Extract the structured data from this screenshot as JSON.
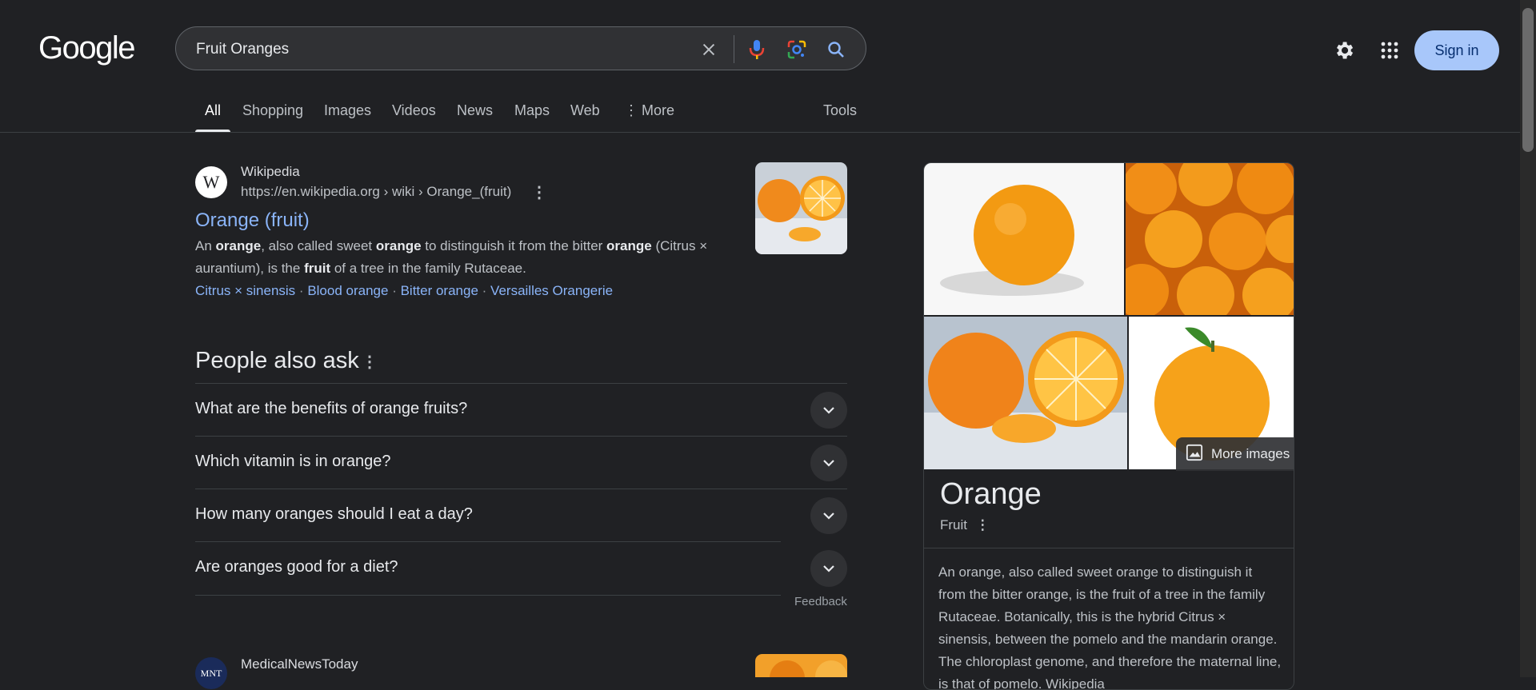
{
  "header": {
    "logo": "Google",
    "search_value": "Fruit Oranges",
    "signin_label": "Sign in"
  },
  "tabs": [
    {
      "label": "All",
      "active": true
    },
    {
      "label": "Shopping"
    },
    {
      "label": "Images"
    },
    {
      "label": "Videos"
    },
    {
      "label": "News"
    },
    {
      "label": "Maps"
    },
    {
      "label": "Web"
    },
    {
      "label": "More"
    }
  ],
  "tools_label": "Tools",
  "result": {
    "site_name": "Wikipedia",
    "url": "https://en.wikipedia.org › wiki › Orange_(fruit)",
    "favicon_letter": "W",
    "title": "Orange (fruit)",
    "snippet_parts": [
      "An ",
      "orange",
      ", also called sweet ",
      "orange",
      " to distinguish it from the bitter ",
      "orange",
      " (Citrus × aurantium), is the ",
      "fruit",
      " of a tree in the family Rutaceae."
    ],
    "sitelinks": [
      "Citrus × sinensis",
      "Blood orange",
      "Bitter orange",
      "Versailles Orangerie"
    ]
  },
  "paa": {
    "title": "People also ask",
    "questions": [
      "What are the benefits of orange fruits?",
      "Which vitamin is in orange?",
      "How many oranges should I eat a day?",
      "Are oranges good for a diet?"
    ],
    "feedback": "Feedback"
  },
  "result2": {
    "site_name": "MedicalNewsToday",
    "favicon_letters": "MNT"
  },
  "knowledge_panel": {
    "more_images_label": "More images",
    "title": "Orange",
    "subtitle": "Fruit",
    "description": "An orange, also called sweet orange to distinguish it from the bitter orange, is the fruit of a tree in the family Rutaceae. Botanically, this is the hybrid Citrus × sinensis, between the pomelo and the mandarin orange. The chloroplast genome, and therefore the maternal line, is that of pomelo. Wikipedia"
  },
  "colors": {
    "background": "#202124",
    "link": "#8ab4f8",
    "signin_bg": "#a8c7fa"
  }
}
